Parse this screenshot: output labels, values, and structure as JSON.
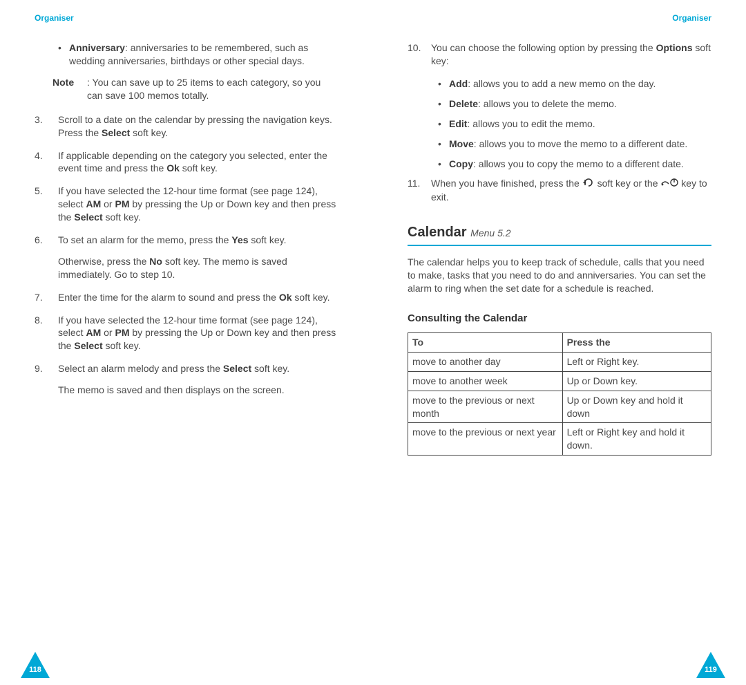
{
  "left": {
    "header": "Organiser",
    "pagenum": "118",
    "bullet_anniv": {
      "label": "Anniversary",
      "text": ": anniversaries to be remembered, such as wedding anniversaries, birthdays or other special days."
    },
    "note": {
      "label": "Note",
      "text": ": You can save up to 25 items to each category, so you can save 100 memos totally."
    },
    "i3": {
      "num": "3.",
      "a": "Scroll to a date on the calendar by pressing the navigation keys. Press the ",
      "b": "Select",
      "c": " soft key."
    },
    "i4": {
      "num": "4.",
      "a": "If applicable depending on the category you selected, enter the event time and press the ",
      "b": "Ok",
      "c": " soft key."
    },
    "i5": {
      "num": "5.",
      "a": "If you have selected the 12-hour time format (see page 124), select ",
      "b": "AM",
      "c": " or ",
      "d": "PM",
      "e": " by pressing the Up or Down key and then press the ",
      "f": "Select",
      "g": " soft key."
    },
    "i6": {
      "num": "6.",
      "a": "To set an alarm for the memo, press the ",
      "b": "Yes",
      "c": " soft key.",
      "sub_a": "Otherwise, press the ",
      "sub_b": "No",
      "sub_c": " soft key. The memo is saved immediately. Go to step 10."
    },
    "i7": {
      "num": "7.",
      "a": "Enter the time for the alarm to sound and press the ",
      "b": "Ok",
      "c": " soft key."
    },
    "i8": {
      "num": "8.",
      "a": "If you have selected the 12-hour time format (see page 124), select ",
      "b": "AM",
      "c": " or ",
      "d": "PM",
      "e": " by pressing the Up or Down key and then press the ",
      "f": "Select",
      "g": " soft key."
    },
    "i9": {
      "num": "9.",
      "a": "Select an alarm melody and press the ",
      "b": "Select",
      "c": " soft key.",
      "sub": "The memo is saved and then displays on the screen."
    }
  },
  "right": {
    "header": "Organiser",
    "pagenum": "119",
    "i10": {
      "num": "10.",
      "a": "You can choose the following option by pressing the ",
      "b": "Options",
      "c": " soft key:"
    },
    "opts": {
      "add": {
        "label": "Add",
        "text": ": allows you to add a new memo on the day."
      },
      "del": {
        "label": "Delete",
        "text": ": allows you to delete the memo."
      },
      "edit": {
        "label": "Edit",
        "text": ": allows you to edit the memo."
      },
      "move": {
        "label": "Move",
        "text": ": allows you to move the memo to a different date."
      },
      "copy": {
        "label": "Copy",
        "text": ": allows you to copy the memo to a different date."
      }
    },
    "i11": {
      "num": "11.",
      "a": "When you have finished, press the ",
      "b": " soft key or the ",
      "c": " key to exit."
    },
    "cal_head": "Calendar",
    "cal_menu": "Menu 5.2",
    "cal_intro": "The calendar helps you to keep track of schedule, calls that you need to make, tasks that you need to do and anniversaries. You can set the alarm to ring when the set date for a schedule is reached.",
    "consult_head": "Consulting the Calendar",
    "table": {
      "th1": "To",
      "th2": "Press the",
      "rows": [
        {
          "to": "move to another day",
          "press": "Left or Right key."
        },
        {
          "to": "move to another week",
          "press": "Up or Down key."
        },
        {
          "to": "move to the previous or next month",
          "press": "Up or Down key and hold it down"
        },
        {
          "to": "move to the previous or next year",
          "press": "Left or Right key and hold it down."
        }
      ]
    }
  }
}
